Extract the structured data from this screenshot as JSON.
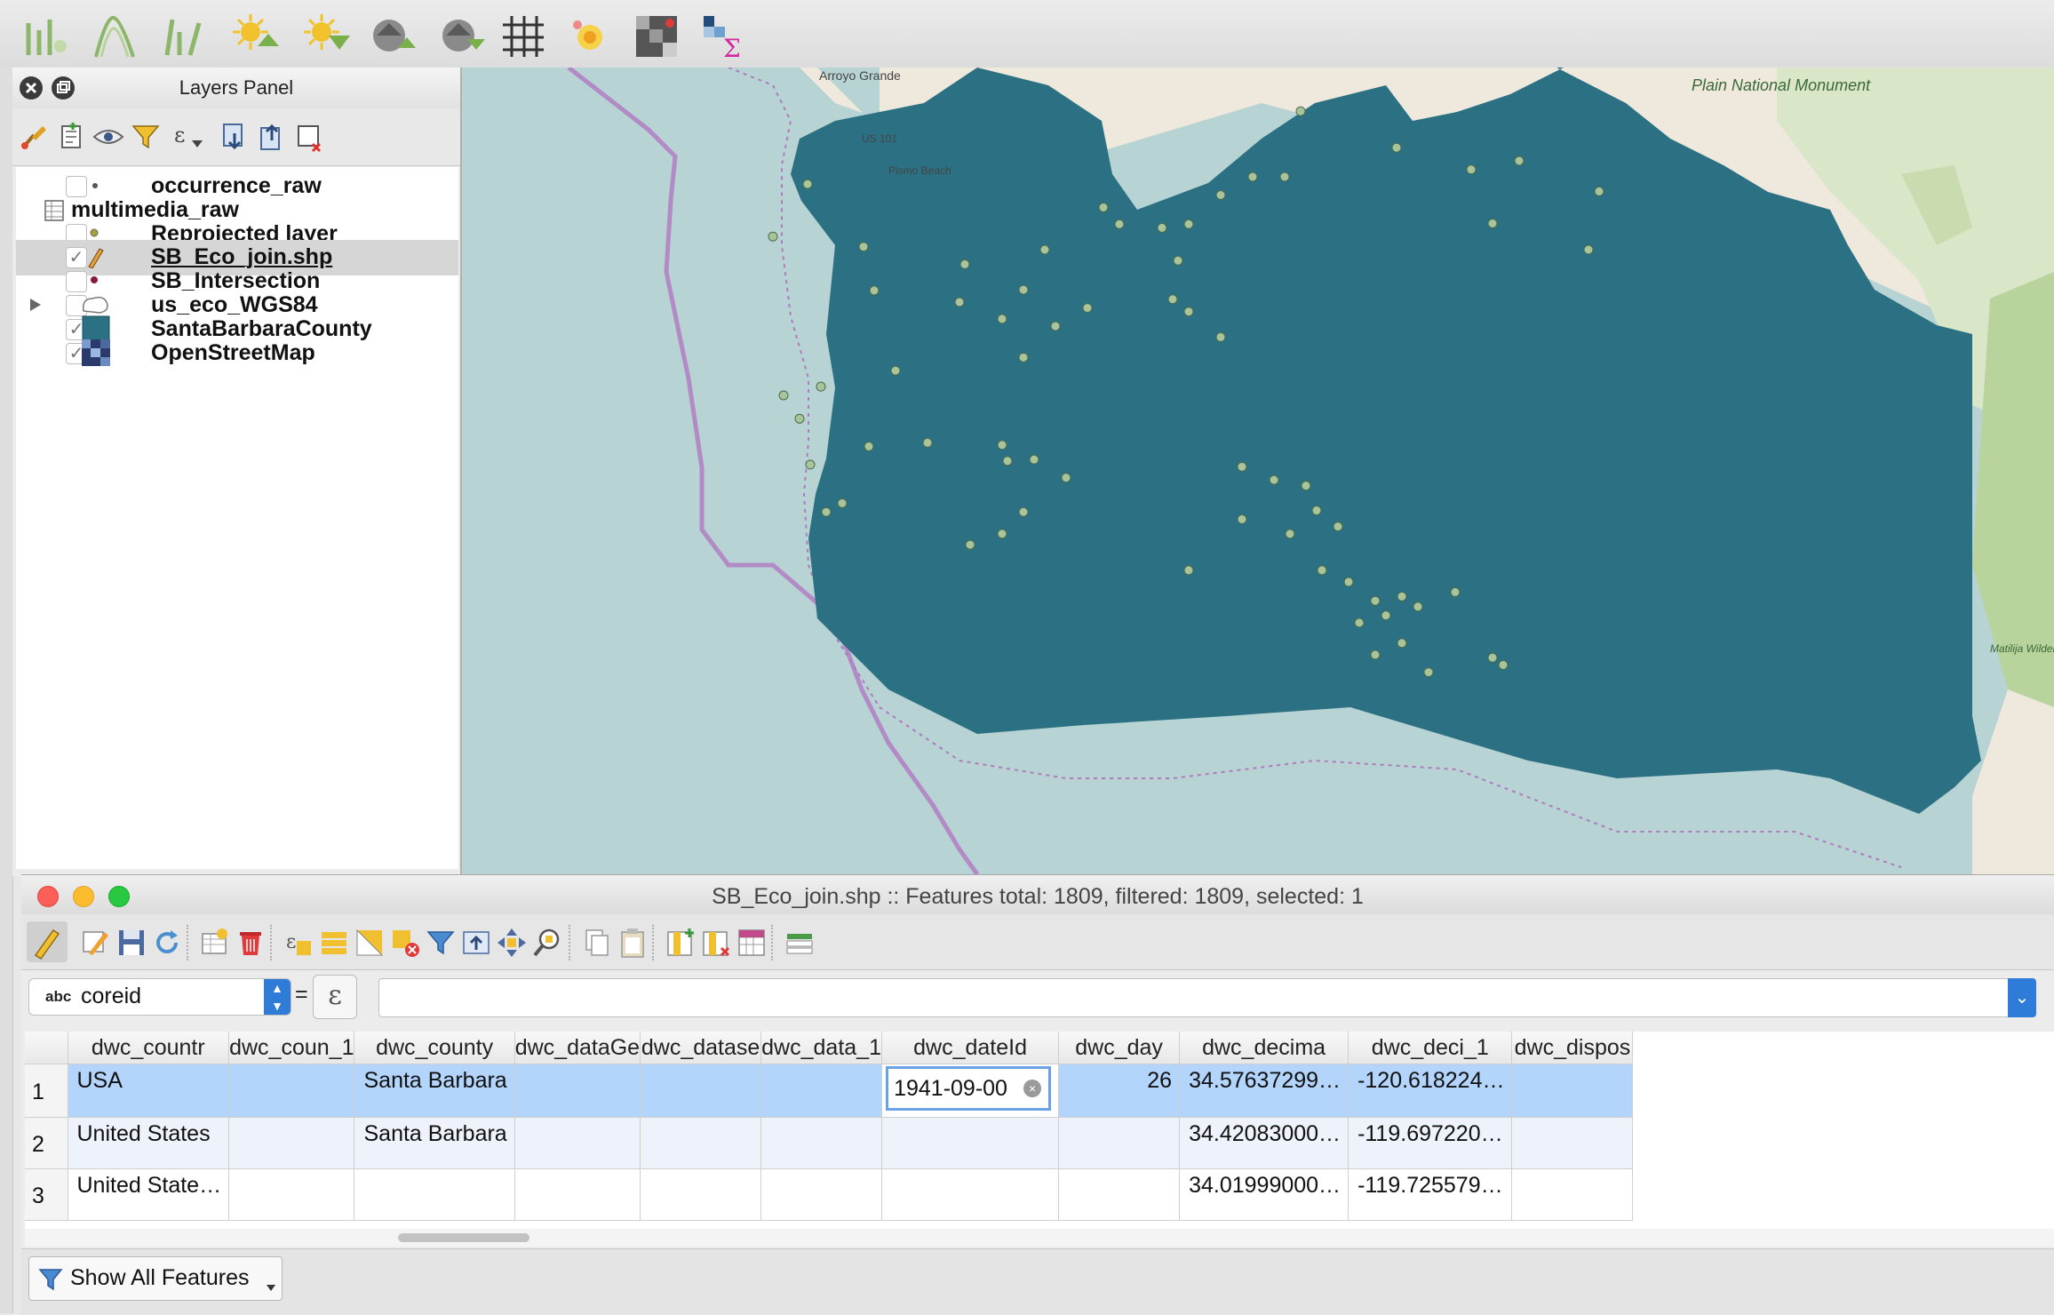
{
  "top_toolbar": {
    "icons": [
      "point-displacement-icon",
      "contour-icon",
      "line-density-icon",
      "sun-add-icon",
      "sun-remove-icon",
      "query-layer-icon",
      "query-layer-2-icon",
      "grid-icon",
      "heatmap-icon",
      "raster-calc-icon",
      "zonal-stats-icon"
    ]
  },
  "layers_panel": {
    "title": "Layers Panel",
    "layers": [
      {
        "name": "occurrence_raw",
        "checked": false,
        "symbol": "point-small"
      },
      {
        "name": "multimedia_raw",
        "checked": null,
        "symbol": "table"
      },
      {
        "name": "Reprojected layer",
        "checked": false,
        "symbol": "point-olive"
      },
      {
        "name": "SB_Eco_join.shp",
        "checked": true,
        "symbol": "edit-pencil",
        "selected": true
      },
      {
        "name": "SB_Intersection",
        "checked": false,
        "symbol": "point-maroon"
      },
      {
        "name": "us_eco_WGS84",
        "checked": false,
        "symbol": "polygon-white",
        "expandable": true
      },
      {
        "name": "SantaBarbaraCounty",
        "checked": true,
        "symbol": "polygon-teal"
      },
      {
        "name": "OpenStreetMap",
        "checked": true,
        "symbol": "raster"
      }
    ],
    "check_mark": "✓"
  },
  "map": {
    "labels": [
      "Arroyo Grande",
      "US 101",
      "Pismo Beach",
      "Plain National Monument",
      "Matilija Wilderness"
    ],
    "county_color": "#2b7183",
    "ocean_color": "#b7d3d3",
    "land_color": "#eee9dc"
  },
  "attribute_table": {
    "title": "SB_Eco_join.shp :: Features total: 1809, filtered: 1809, selected: 1",
    "field_type": "abc",
    "field_name": "coreid",
    "equals": "=",
    "expression_symbol": "ε",
    "columns": [
      "dwc_countr",
      "dwc_coun_1",
      "dwc_county",
      "dwc_dataGe",
      "dwc_datase",
      "dwc_data_1",
      "dwc_dateId",
      "dwc_day",
      "dwc_decima",
      "dwc_deci_1",
      "dwc_dispos"
    ],
    "rows": [
      {
        "num": "1",
        "cells": [
          "USA",
          "",
          "Santa Barbara",
          "",
          "",
          "",
          "1941-09-00",
          "26",
          "34.57637299…",
          "-120.618224…",
          ""
        ]
      },
      {
        "num": "2",
        "cells": [
          "United States",
          "",
          "Santa Barbara",
          "",
          "",
          "",
          "",
          "",
          "34.42083000…",
          "-119.697220…",
          ""
        ]
      },
      {
        "num": "3",
        "cells": [
          "United State…",
          "",
          "",
          "",
          "",
          "",
          "",
          "",
          "34.01999000…",
          "-119.725579…",
          ""
        ]
      }
    ],
    "editing_value": "1941-09-00",
    "show_all_label": "Show All Features"
  }
}
